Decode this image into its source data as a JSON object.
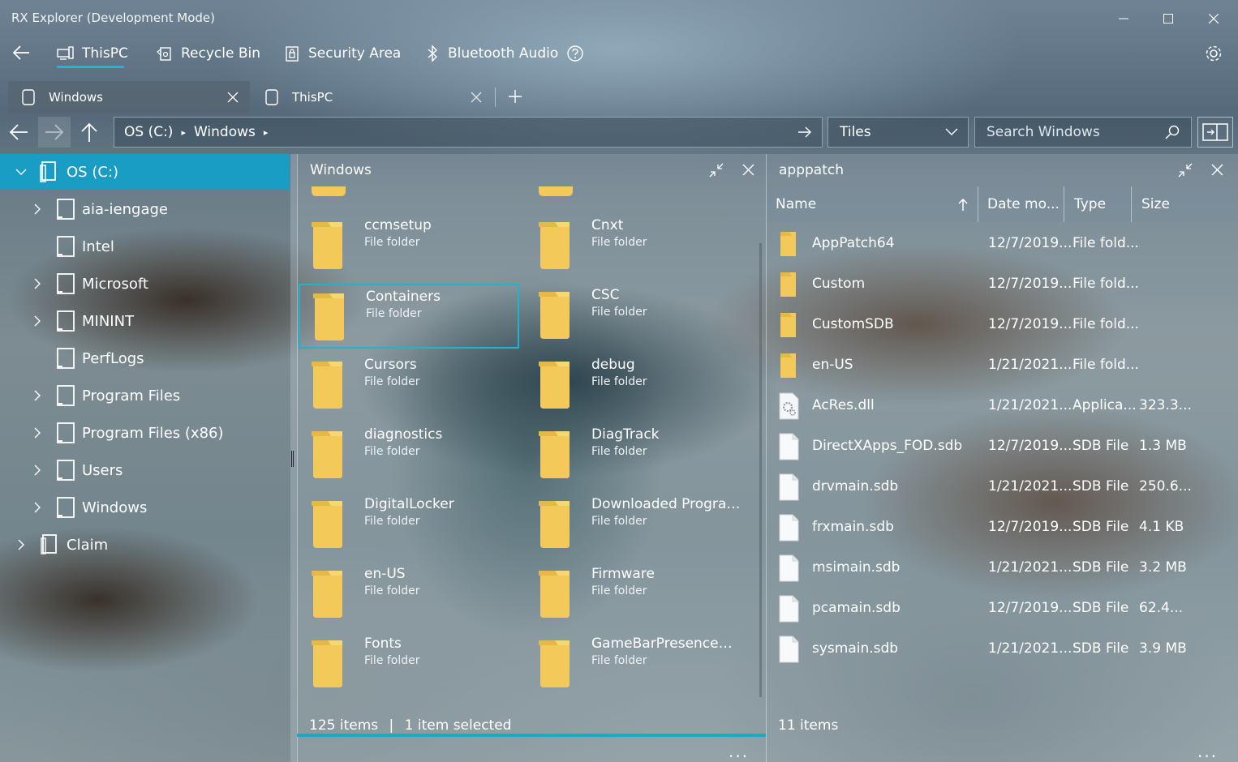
{
  "window": {
    "title": "RX Explorer (Development Mode)"
  },
  "nav": {
    "items": [
      {
        "label": "ThisPC"
      },
      {
        "label": "Recycle Bin"
      },
      {
        "label": "Security Area"
      },
      {
        "label": "Bluetooth Audio"
      }
    ]
  },
  "tabs": [
    {
      "label": "Windows",
      "active": true
    },
    {
      "label": "ThisPC",
      "active": false
    }
  ],
  "address": {
    "segments": [
      "OS (C:)",
      "Windows"
    ],
    "view_mode": "Tiles",
    "search_placeholder": "Search Windows"
  },
  "tree": {
    "root": "OS (C:)",
    "children": [
      {
        "label": "aia-iengage",
        "expandable": true
      },
      {
        "label": "Intel",
        "expandable": false
      },
      {
        "label": "Microsoft",
        "expandable": true
      },
      {
        "label": "MININT",
        "expandable": true
      },
      {
        "label": "PerfLogs",
        "expandable": false
      },
      {
        "label": "Program Files",
        "expandable": true
      },
      {
        "label": "Program Files (x86)",
        "expandable": true
      },
      {
        "label": "Users",
        "expandable": true
      },
      {
        "label": "Windows",
        "expandable": true
      }
    ],
    "other_root": "Claim"
  },
  "left_pane": {
    "title": "Windows",
    "tiles": [
      {
        "name": "ccmsetup",
        "type": "File folder"
      },
      {
        "name": "Cnxt",
        "type": "File folder"
      },
      {
        "name": "Containers",
        "type": "File folder",
        "selected": true
      },
      {
        "name": "CSC",
        "type": "File folder"
      },
      {
        "name": "Cursors",
        "type": "File folder"
      },
      {
        "name": "debug",
        "type": "File folder"
      },
      {
        "name": "diagnostics",
        "type": "File folder"
      },
      {
        "name": "DiagTrack",
        "type": "File folder"
      },
      {
        "name": "DigitalLocker",
        "type": "File folder"
      },
      {
        "name": "Downloaded Program...",
        "type": "File folder"
      },
      {
        "name": "en-US",
        "type": "File folder"
      },
      {
        "name": "Firmware",
        "type": "File folder"
      },
      {
        "name": "Fonts",
        "type": "File folder"
      },
      {
        "name": "GameBarPresenceWriter",
        "type": "File folder"
      }
    ],
    "status_count": "125 items",
    "status_selected": "1 item selected",
    "more": "..."
  },
  "right_pane": {
    "title": "apppatch",
    "columns": {
      "name": "Name",
      "date": "Date mo...",
      "type": "Type",
      "size": "Size"
    },
    "rows": [
      {
        "name": "AppPatch64",
        "date": "12/7/2019...",
        "type": "File fold...",
        "size": "",
        "kind": "folder"
      },
      {
        "name": "Custom",
        "date": "12/7/2019...",
        "type": "File fold...",
        "size": "",
        "kind": "folder"
      },
      {
        "name": "CustomSDB",
        "date": "12/7/2019...",
        "type": "File fold...",
        "size": "",
        "kind": "folder"
      },
      {
        "name": "en-US",
        "date": "1/21/2021...",
        "type": "File fold...",
        "size": "",
        "kind": "folder"
      },
      {
        "name": "AcRes.dll",
        "date": "1/21/2021...",
        "type": "Applica...",
        "size": "323.3...",
        "kind": "dll"
      },
      {
        "name": "DirectXApps_FOD.sdb",
        "date": "12/7/2019...",
        "type": "SDB File",
        "size": "1.3 MB",
        "kind": "file"
      },
      {
        "name": "drvmain.sdb",
        "date": "1/21/2021...",
        "type": "SDB File",
        "size": "250.6...",
        "kind": "file"
      },
      {
        "name": "frxmain.sdb",
        "date": "12/7/2019...",
        "type": "SDB File",
        "size": "4.1 KB",
        "kind": "file"
      },
      {
        "name": "msimain.sdb",
        "date": "1/21/2021...",
        "type": "SDB File",
        "size": "3.2 MB",
        "kind": "file"
      },
      {
        "name": "pcamain.sdb",
        "date": "12/7/2019...",
        "type": "SDB File",
        "size": "62.4...",
        "kind": "file"
      },
      {
        "name": "sysmain.sdb",
        "date": "1/21/2021...",
        "type": "SDB File",
        "size": "3.9 MB",
        "kind": "file"
      }
    ],
    "status_count": "11 items",
    "more": "..."
  },
  "colors": {
    "accent": "#1a9dc4",
    "folder": "#f3c95a"
  }
}
